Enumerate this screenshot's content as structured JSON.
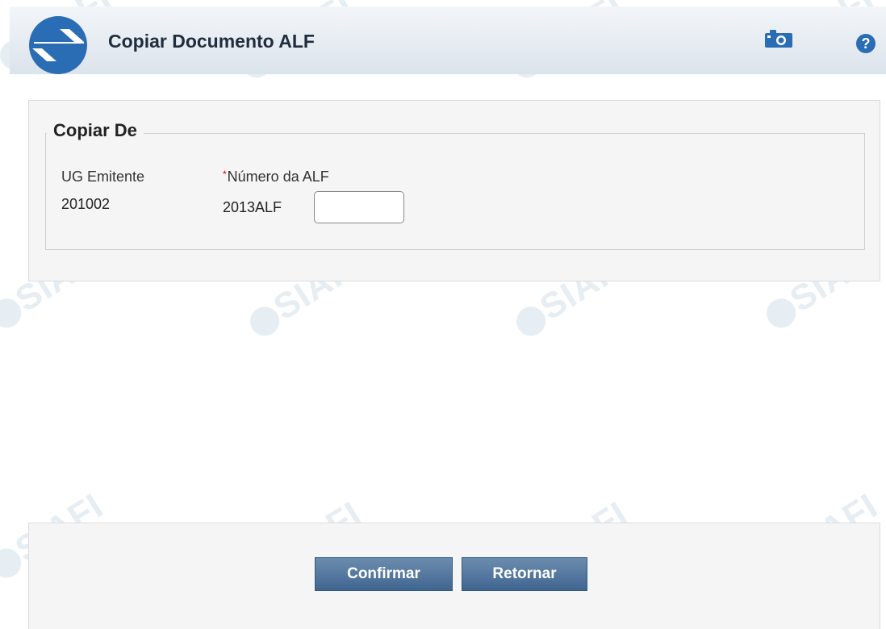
{
  "header": {
    "title": "Copiar Documento ALF"
  },
  "form": {
    "legend": "Copiar De",
    "ug_emitente_label": "UG Emitente",
    "ug_emitente_value": "201002",
    "numero_alf_label": "Número da ALF",
    "required_mark": "*",
    "numero_alf_prefix": "2013ALF",
    "numero_alf_value": ""
  },
  "footer": {
    "confirm_label": "Confirmar",
    "return_label": "Retornar"
  },
  "watermark": {
    "text": "SIAFI"
  },
  "icons": {
    "camera": "camera-icon",
    "help": "help-icon",
    "logo": "siafi-logo"
  },
  "colors": {
    "button": "#4a6e96",
    "logo_blue": "#2a6db5",
    "required": "#cc0000"
  }
}
